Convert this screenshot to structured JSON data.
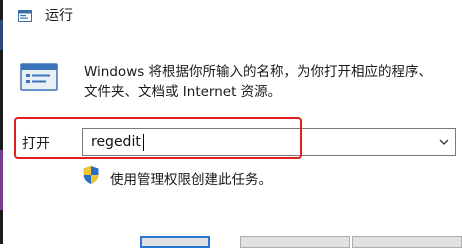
{
  "window": {
    "title": "运行"
  },
  "description": {
    "line1": "Windows 将根据你所输入的名称，为你打开相应的程序、",
    "line2": "文件夹、文档或 Internet 资源。"
  },
  "open_field": {
    "label": "打开",
    "value": "regedit"
  },
  "admin_note": "使用管理权限创建此任务。",
  "colors": {
    "highlight": "#e02020",
    "shield_blue": "#2b6cc4",
    "shield_yellow": "#f2c12e",
    "accent": "#2b78d4"
  },
  "icons": {
    "title": "run-icon",
    "app": "run-program-icon",
    "shield": "uac-shield-icon",
    "dropdown": "chevron-down-icon"
  }
}
